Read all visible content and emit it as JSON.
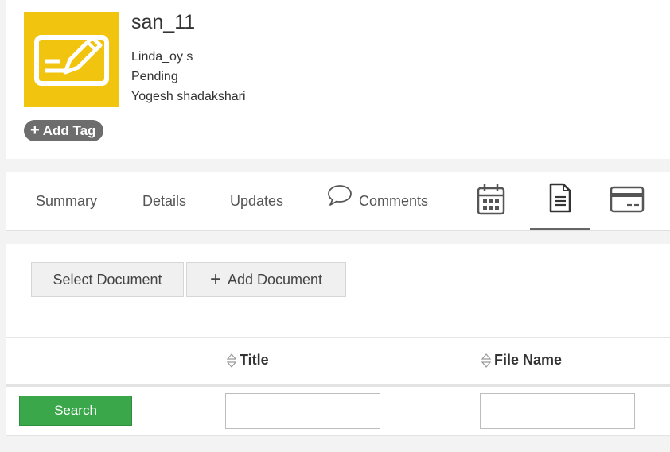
{
  "record": {
    "title": "san_11",
    "line1": "Linda_oy s",
    "line2": "Pending",
    "line3": "Yogesh shadakshari",
    "add_tag": "Add Tag"
  },
  "tabs": {
    "summary": "Summary",
    "details": "Details",
    "updates": "Updates",
    "comments": "Comments"
  },
  "documents": {
    "select_label": "Select Document",
    "add_label": "Add Document",
    "columns": [
      "Title",
      "File Name"
    ],
    "search_label": "Search"
  },
  "colors": {
    "thumb": "#f1c40f",
    "tag": "#6d6d6d",
    "search": "#3aa84a"
  },
  "icons": {
    "thumb": "edit-document-icon",
    "comments": "comment-bubble-icon",
    "calendar": "calendar-icon",
    "documents": "document-icon",
    "card": "card-icon"
  }
}
